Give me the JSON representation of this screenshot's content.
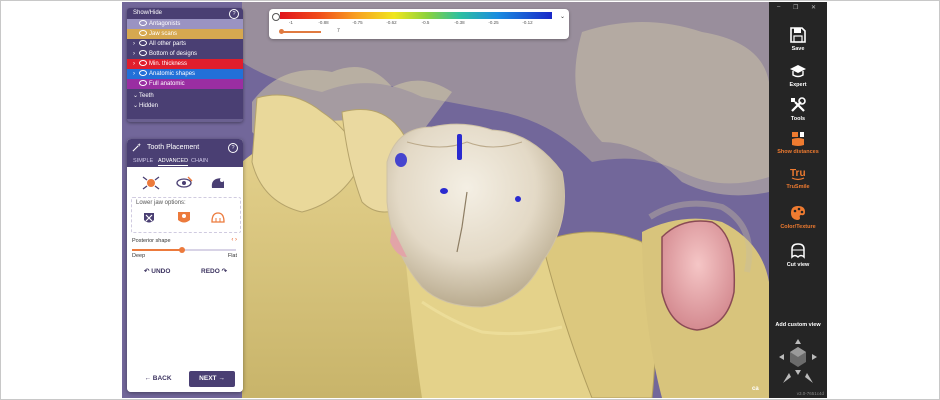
{
  "show_hide": {
    "title": "Show/Hide",
    "help": "?",
    "items": [
      {
        "label": "Antagonists",
        "color": "#9a93c2"
      },
      {
        "label": "Jaw scans",
        "color": "#d6a850"
      },
      {
        "label": "All other parts",
        "color": "#4a3f73"
      },
      {
        "label": "Bottom of designs",
        "color": "#4a3f73"
      },
      {
        "label": "Min. thickness",
        "color": "#e01e2c"
      },
      {
        "label": "Anatomic shapes",
        "color": "#2270d8"
      },
      {
        "label": "Full anatomic",
        "color": "#9a2ea2"
      }
    ],
    "section_teeth": "Teeth",
    "section_hidden": "Hidden"
  },
  "tooth_placement": {
    "title": "Tooth Placement",
    "help": "?",
    "tabs": [
      "SIMPLE",
      "ADVANCED",
      "CHAIN"
    ],
    "active_tab": "ADVANCED",
    "lower_jaw_label": "Lower jaw options:",
    "slider": {
      "label": "Posterior shape",
      "min_label": "Deep",
      "max_label": "Flat",
      "value": 0.48
    },
    "undo": "UNDO",
    "redo": "REDO",
    "back": "BACK",
    "next": "NEXT"
  },
  "distance_scale": {
    "ticks": [
      "-1",
      "-0.88",
      "-0.75",
      "-0.62",
      "-0.5",
      "-0.38",
      "-0.25",
      "-0.12"
    ],
    "value": "7"
  },
  "toolbar": {
    "items": [
      {
        "label": "Save",
        "icon": "floppy-icon"
      },
      {
        "label": "Expert",
        "icon": "graduation-cap-icon"
      },
      {
        "label": "Tools",
        "icon": "tools-icon"
      },
      {
        "label": "Show distances",
        "icon": "distances-icon"
      },
      {
        "label": "TruSmile",
        "icon": "trusmile-icon"
      },
      {
        "label": "Color/Texture",
        "icon": "palette-icon"
      },
      {
        "label": "Cut view",
        "icon": "cut-view-icon"
      }
    ],
    "add_view": "Add custom view",
    "version": "v3.0-7651c4d",
    "accent": "#ef7b30"
  },
  "watermark": "ca"
}
